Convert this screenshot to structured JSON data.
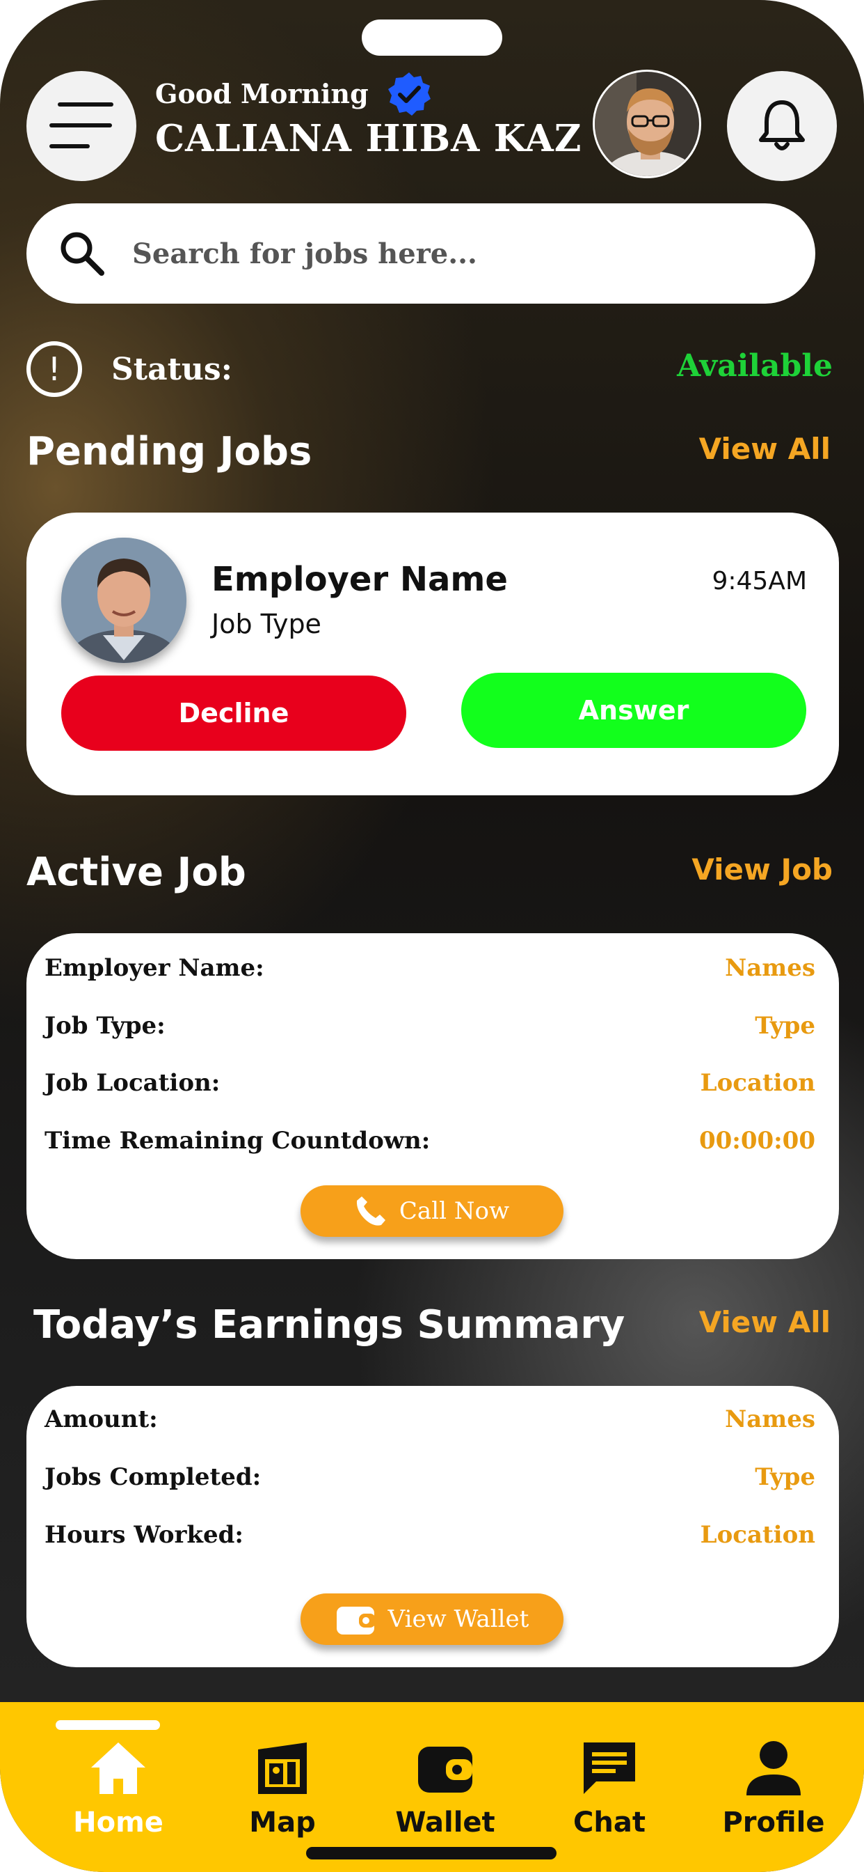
{
  "header": {
    "greeting": "Good Morning",
    "user_name": "CALIANA HIBA KAZ"
  },
  "search": {
    "placeholder": "Search for jobs here..."
  },
  "status": {
    "label": "Status:",
    "value": "Available"
  },
  "pending_jobs": {
    "title": "Pending Jobs",
    "link": "View All",
    "employer_name": "Employer Name",
    "job_type": "Job Type",
    "time": "9:45AM",
    "decline_label": "Decline",
    "answer_label": "Answer"
  },
  "active_job": {
    "title": "Active Job",
    "link": "View Job",
    "rows": [
      {
        "key": "Employer Name:",
        "value": "Names"
      },
      {
        "key": "Job Type:",
        "value": "Type"
      },
      {
        "key": "Job Location:",
        "value": "Location"
      },
      {
        "key": "Time Remaining Countdown:",
        "value": "00:00:00"
      }
    ],
    "button_label": "Call Now"
  },
  "earnings": {
    "title": "Today’s Earnings Summary",
    "link": "View All",
    "rows": [
      {
        "key": "Amount:",
        "value": "Names"
      },
      {
        "key": "Jobs Completed:",
        "value": "Type"
      },
      {
        "key": "Hours Worked:",
        "value": "Location"
      }
    ],
    "button_label": "View Wallet"
  },
  "nav": {
    "items": [
      {
        "label": "Home",
        "icon": "home-icon",
        "active": true
      },
      {
        "label": "Map",
        "icon": "map-icon"
      },
      {
        "label": "Wallet",
        "icon": "wallet-icon"
      },
      {
        "label": "Chat",
        "icon": "chat-icon"
      },
      {
        "label": "Profile",
        "icon": "profile-icon"
      }
    ]
  },
  "colors": {
    "accent": "#f5a623",
    "available": "#1ed238",
    "decline": "#e8001c",
    "answer": "#12ff1c",
    "navbar": "#ffc700"
  }
}
